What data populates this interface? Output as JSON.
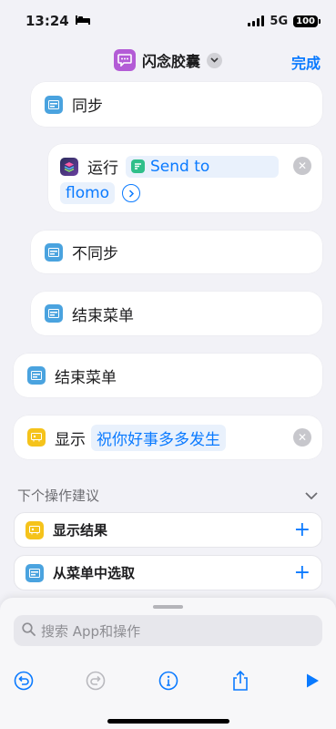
{
  "status": {
    "time": "13:24",
    "network": "5G",
    "battery": "100"
  },
  "nav": {
    "title": "闪念胶囊",
    "done": "完成"
  },
  "actions": {
    "sync": "同步",
    "run": {
      "verb": "运行",
      "shortcut_part1": "Send to",
      "shortcut_part2": "flomo"
    },
    "no_sync": "不同步",
    "end_menu_inner": "结束菜单",
    "end_menu_outer": "结束菜单",
    "show": {
      "verb": "显示",
      "text": "祝你好事多多发生"
    }
  },
  "suggestions": {
    "header": "下个操作建议",
    "items": [
      {
        "label": "显示结果"
      },
      {
        "label": "从菜单中选取"
      }
    ]
  },
  "search": {
    "placeholder": "搜索 App和操作"
  },
  "colors": {
    "accent": "#0a7aff",
    "menu_icon": "#4aa3df",
    "show_icon": "#f5c31b",
    "app_icon": "#b35bd6"
  },
  "icons": {
    "toolbar": [
      "undo-icon",
      "redo-icon",
      "info-icon",
      "share-icon",
      "play-icon"
    ]
  }
}
